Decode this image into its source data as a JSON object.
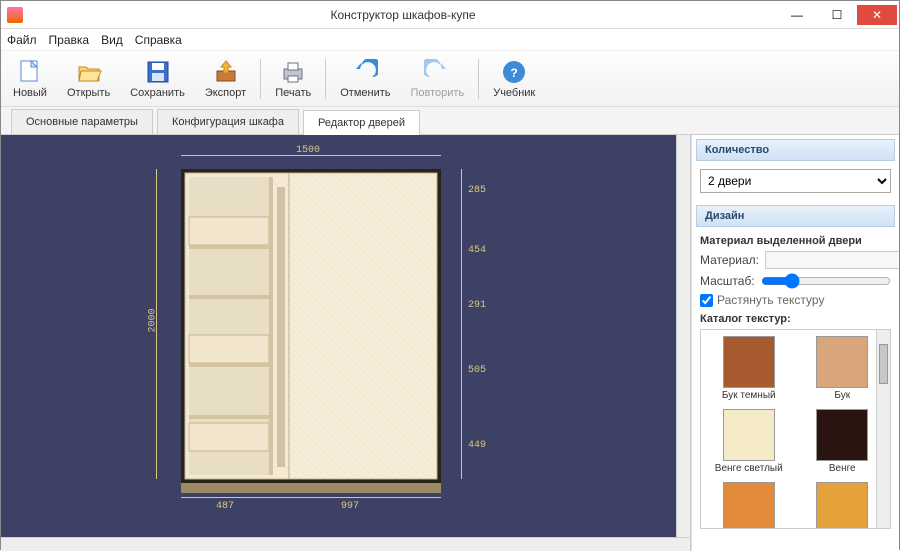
{
  "window": {
    "title": "Конструктор шкафов-купе"
  },
  "menu": {
    "file": "Файл",
    "edit": "Правка",
    "view": "Вид",
    "help": "Справка"
  },
  "toolbar": {
    "new": "Новый",
    "open": "Открыть",
    "save": "Сохранить",
    "export": "Экспорт",
    "print": "Печать",
    "undo": "Отменить",
    "redo": "Повторить",
    "tutorial": "Учебник"
  },
  "tabs": {
    "t1": "Основные параметры",
    "t2": "Конфигурация шкафа",
    "t3": "Редактор дверей"
  },
  "dimensions": {
    "top_width": "1500",
    "left_height": "2000",
    "right_segments": [
      "285",
      "454",
      "291",
      "505",
      "449"
    ],
    "bottom_segments": [
      "487",
      "997"
    ]
  },
  "side": {
    "qty_header": "Количество",
    "qty_selected": "2 двери",
    "design_header": "Дизайн",
    "door_material_title": "Материал выделенной двери",
    "material_label": "Материал:",
    "material_value": "",
    "scale_label": "Масштаб:",
    "stretch_label": "Растянуть текстуру",
    "stretch_checked": true,
    "catalog_label": "Каталог текстур:",
    "swatches": [
      {
        "name": "Бук темный",
        "color": "#a65a2e"
      },
      {
        "name": "Бук",
        "color": "#d9a57a"
      },
      {
        "name": "Венге светлый",
        "color": "#f4eac8"
      },
      {
        "name": "Венге",
        "color": "#2a1410"
      },
      {
        "name": "",
        "color": "#e08a3a"
      },
      {
        "name": "",
        "color": "#e6a23a"
      }
    ]
  }
}
